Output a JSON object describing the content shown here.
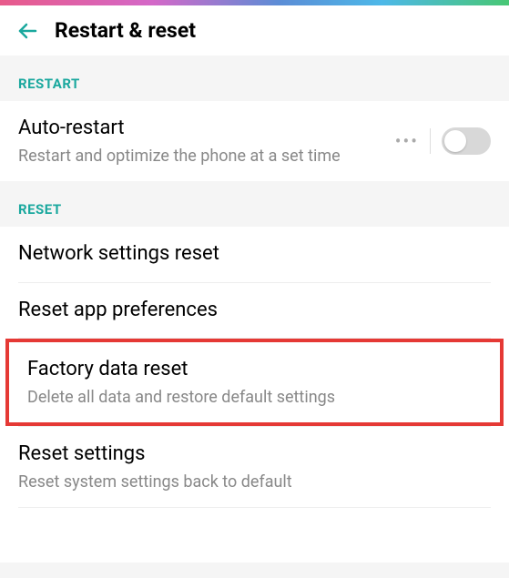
{
  "header": {
    "title": "Restart & reset"
  },
  "sections": {
    "restart": {
      "label": "RESTART",
      "auto_restart": {
        "title": "Auto-restart",
        "subtitle": "Restart and optimize the phone at a set time",
        "toggled": false
      }
    },
    "reset": {
      "label": "RESET",
      "network": {
        "title": "Network settings reset"
      },
      "app_prefs": {
        "title": "Reset app preferences"
      },
      "factory": {
        "title": "Factory data reset",
        "subtitle": "Delete all data and restore default settings"
      },
      "settings": {
        "title": "Reset settings",
        "subtitle": "Reset system settings back to default"
      }
    }
  }
}
